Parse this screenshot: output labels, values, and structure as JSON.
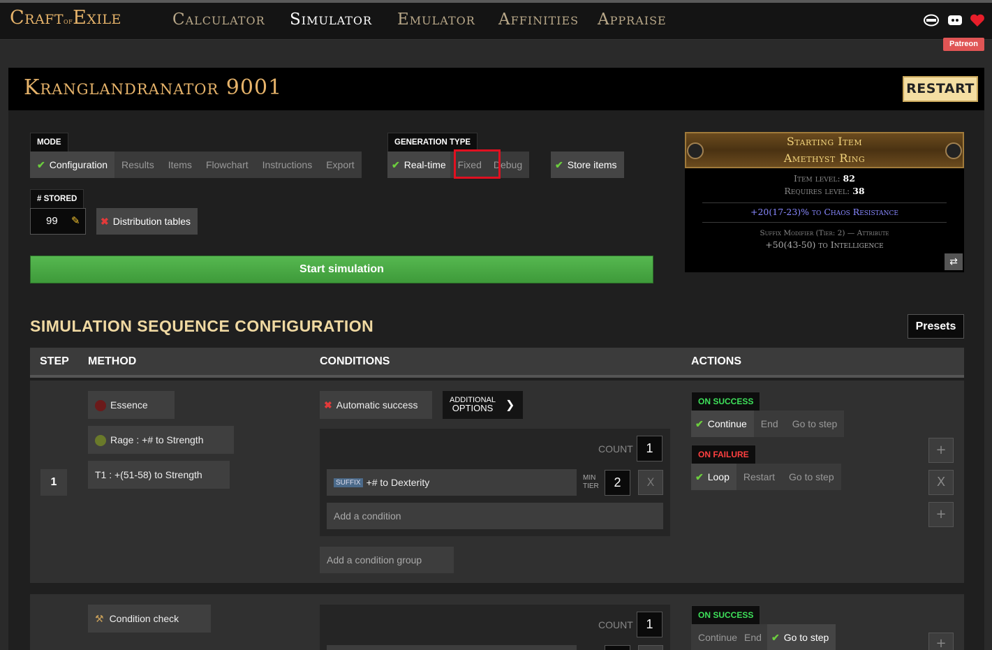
{
  "nav": {
    "logo_main1": "Craft",
    "logo_of": "of",
    "logo_main2": "Exile",
    "links": [
      "Calculator",
      "Simulator",
      "Emulator",
      "Affinities",
      "Appraise"
    ],
    "patreon": "Patreon"
  },
  "header": {
    "title": "Kranglandranator 9001",
    "restart": "RESTART"
  },
  "mode": {
    "label": "MODE",
    "tabs": [
      "Configuration",
      "Results",
      "Items",
      "Flowchart",
      "Instructions",
      "Export"
    ]
  },
  "generation": {
    "label": "GENERATION TYPE",
    "tabs": [
      "Real-time",
      "Fixed",
      "Debug"
    ],
    "store_items": "Store items"
  },
  "stored": {
    "label": "# STORED",
    "value": "99",
    "distribution": "Distribution tables"
  },
  "start_simulation": "Start simulation",
  "item": {
    "header1": "Starting Item",
    "header2": "Amethyst Ring",
    "ilvl_label": "Item level:",
    "ilvl": "82",
    "req_label": "Requires level:",
    "req": "38",
    "implicit": "+20(17-23)% to Chaos Resistance",
    "mod_header": "Suffix Modifier (Tier: 2) — Attribute",
    "mod": "+50(43-50) to Intelligence",
    "swap_icon": "swap-icon"
  },
  "sequence": {
    "title": "SIMULATION SEQUENCE CONFIGURATION",
    "presets": "Presets",
    "headers": {
      "step": "STEP",
      "method": "METHOD",
      "conditions": "CONDITIONS",
      "actions": "ACTIONS"
    },
    "step1": {
      "number": "1",
      "method": "Essence",
      "essence": "Rage : +# to Strength",
      "tier": "T1 : +(51-58) to Strength",
      "auto_success": "Automatic success",
      "additional1": "ADDITIONAL",
      "additional2": "OPTIONS",
      "count_label": "COUNT",
      "count": "1",
      "cond_tag": "SUFFIX",
      "cond_text": "+# to Dexterity",
      "min_tier1": "MIN",
      "min_tier2": "TIER",
      "min_tier_value": "2",
      "remove": "X",
      "add_condition": "Add a condition",
      "add_group": "Add a condition group",
      "on_success": "ON SUCCESS",
      "success_opts": [
        "Continue",
        "End",
        "Go to step"
      ],
      "on_failure": "ON FAILURE",
      "failure_opts": [
        "Loop",
        "Restart",
        "Go to step"
      ],
      "side": [
        "+",
        "X",
        "+"
      ]
    },
    "step2": {
      "method": "Condition check",
      "count_label": "COUNT",
      "count": "1",
      "on_success": "ON SUCCESS",
      "success_opts": [
        "Continue",
        "End",
        "Go to step"
      ],
      "side": [
        "+"
      ]
    }
  },
  "colors": {
    "accent": "#e6b36a",
    "success": "#3ee05a",
    "failure": "#ff4040",
    "highlight": "#e01020"
  }
}
